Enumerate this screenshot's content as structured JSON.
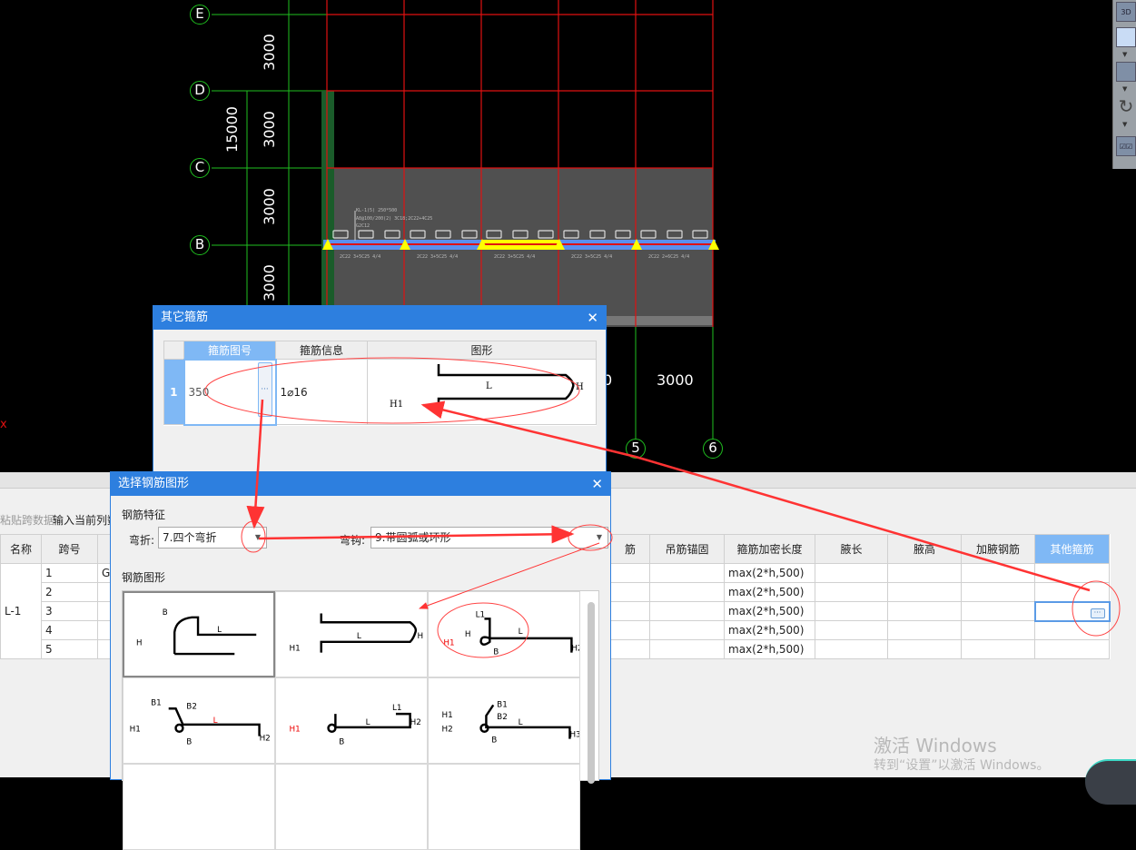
{
  "cad": {
    "axes_rows": [
      "E",
      "D",
      "C",
      "B"
    ],
    "axes_cols": [
      "5",
      "6"
    ],
    "dims_vertical": [
      "3000",
      "3000",
      "3000",
      "3000"
    ],
    "dim_total": "15000",
    "dims_bottom": [
      "0",
      "3000"
    ]
  },
  "toolbar3d": {
    "btn_3d": "3D"
  },
  "bottom_toolbar": {
    "paste_span": "粘贴跨数据",
    "input_column": "输入当前列数据"
  },
  "beam_table": {
    "headers": [
      "名称",
      "跨号",
      "",
      "筋",
      "吊筋锚固",
      "箍筋加密长度",
      "腋长",
      "腋高",
      "加腋钢筋",
      "其他箍筋"
    ],
    "name": "L-1",
    "rows": [
      {
        "span": "1",
        "c3": "G",
        "dense": "max(2*h,500)"
      },
      {
        "span": "2",
        "c3": "",
        "dense": "max(2*h,500)"
      },
      {
        "span": "3",
        "c3": "",
        "dense": "max(2*h,500)"
      },
      {
        "span": "4",
        "c3": "",
        "dense": "max(2*h,500)"
      },
      {
        "span": "5",
        "c3": "",
        "dense": "max(2*h,500)"
      }
    ],
    "ellipsis": "···"
  },
  "other_stirrup_dialog": {
    "title": "其它箍筋",
    "headers": [
      "箍筋图号",
      "箍筋信息",
      "图形"
    ],
    "row": {
      "index": "1",
      "shape_no": "350",
      "info": "1⌀16",
      "ellipsis": "···"
    },
    "shape_labels": {
      "L": "L",
      "H": "H",
      "H1": "H1"
    }
  },
  "select_shape_dialog": {
    "title": "选择钢筋图形",
    "feature_label": "钢筋特征",
    "bend_label": "弯折:",
    "bend_value": "7.四个弯折",
    "hook_label": "弯钩:",
    "hook_value": "9.带圆弧或环形",
    "shape_label": "钢筋图形"
  },
  "watermark": {
    "line1": "激活 Windows",
    "line2": "转到“设置”以激活 Windows。"
  },
  "colors": {
    "accent": "#2d7fdf",
    "annotation": "#ff3333",
    "selected_header": "#7fb8f5"
  }
}
